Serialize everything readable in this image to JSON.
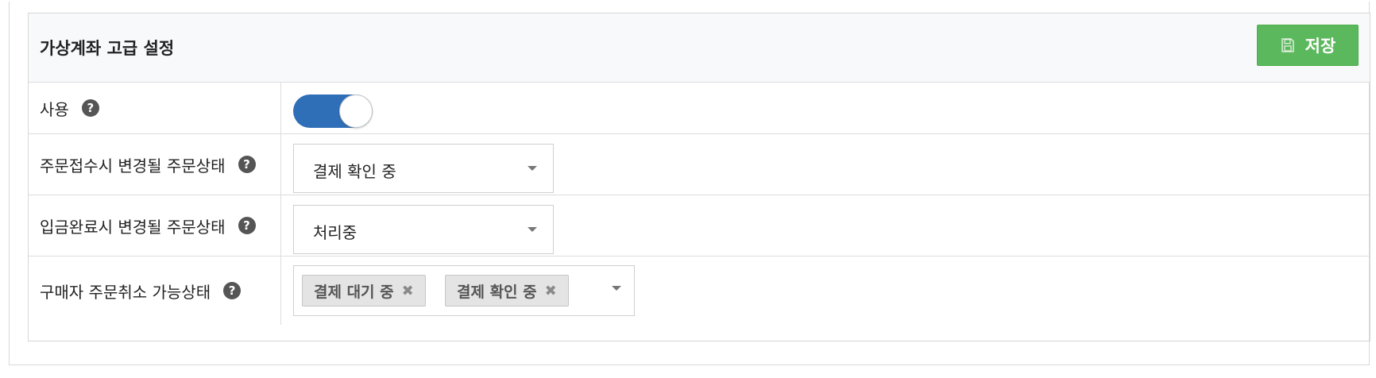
{
  "panel": {
    "title": "가상계좌 고급 설정",
    "save_label": "저장"
  },
  "rows": {
    "use": {
      "label": "사용",
      "enabled": true
    },
    "order_received": {
      "label": "주문접수시 변경될 주문상태",
      "value": "결제 확인 중"
    },
    "deposit_complete": {
      "label": "입금완료시 변경될 주문상태",
      "value": "처리중"
    },
    "cancel_status": {
      "label": "구매자 주문취소 가능상태",
      "tags": [
        "결제 대기 중",
        "결제 확인 중"
      ]
    }
  },
  "icons": {
    "help": "?",
    "tag_remove": "✖"
  },
  "colors": {
    "save_button": "#5cb85c",
    "toggle_on": "#2f6fb8",
    "header_bg": "#f8f9fa"
  }
}
